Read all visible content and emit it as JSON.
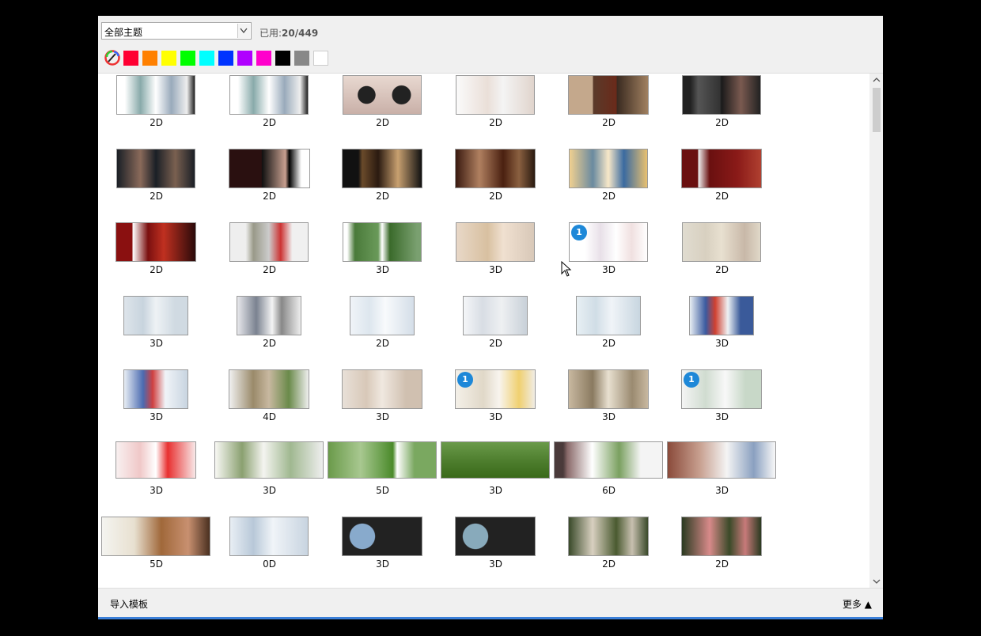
{
  "toolbar": {
    "theme_select_value": "全部主题",
    "usage_label": "已用:",
    "usage_value": "20/449"
  },
  "colors": [
    "#ff0033",
    "#ff8000",
    "#ffff00",
    "#00ff00",
    "#00ffff",
    "#0033ff",
    "#b000ff",
    "#ff00cc",
    "#000000",
    "#888888",
    "#ffffff"
  ],
  "templates": [
    {
      "label": "2D"
    },
    {
      "label": "2D"
    },
    {
      "label": "2D"
    },
    {
      "label": "2D"
    },
    {
      "label": "2D"
    },
    {
      "label": "2D"
    },
    {
      "label": "2D"
    },
    {
      "label": "2D"
    },
    {
      "label": "2D"
    },
    {
      "label": "2D"
    },
    {
      "label": "2D"
    },
    {
      "label": "2D"
    },
    {
      "label": "2D"
    },
    {
      "label": "2D"
    },
    {
      "label": "3D"
    },
    {
      "label": "3D"
    },
    {
      "label": "3D",
      "badge": "1"
    },
    {
      "label": "2D"
    },
    {
      "label": "3D"
    },
    {
      "label": "2D"
    },
    {
      "label": "2D"
    },
    {
      "label": "2D"
    },
    {
      "label": "2D"
    },
    {
      "label": "3D"
    },
    {
      "label": "3D"
    },
    {
      "label": "4D"
    },
    {
      "label": "3D"
    },
    {
      "label": "3D",
      "badge": "1"
    },
    {
      "label": "3D"
    },
    {
      "label": "3D",
      "badge": "1"
    },
    {
      "label": "3D"
    },
    {
      "label": "3D"
    },
    {
      "label": "5D"
    },
    {
      "label": "3D"
    },
    {
      "label": "6D"
    },
    {
      "label": "3D"
    },
    {
      "label": "5D"
    },
    {
      "label": "0D"
    },
    {
      "label": "3D"
    },
    {
      "label": "3D"
    },
    {
      "label": "2D"
    },
    {
      "label": "2D"
    }
  ],
  "footer": {
    "import_label": "导入模板",
    "more_label": "更多 ▲"
  }
}
